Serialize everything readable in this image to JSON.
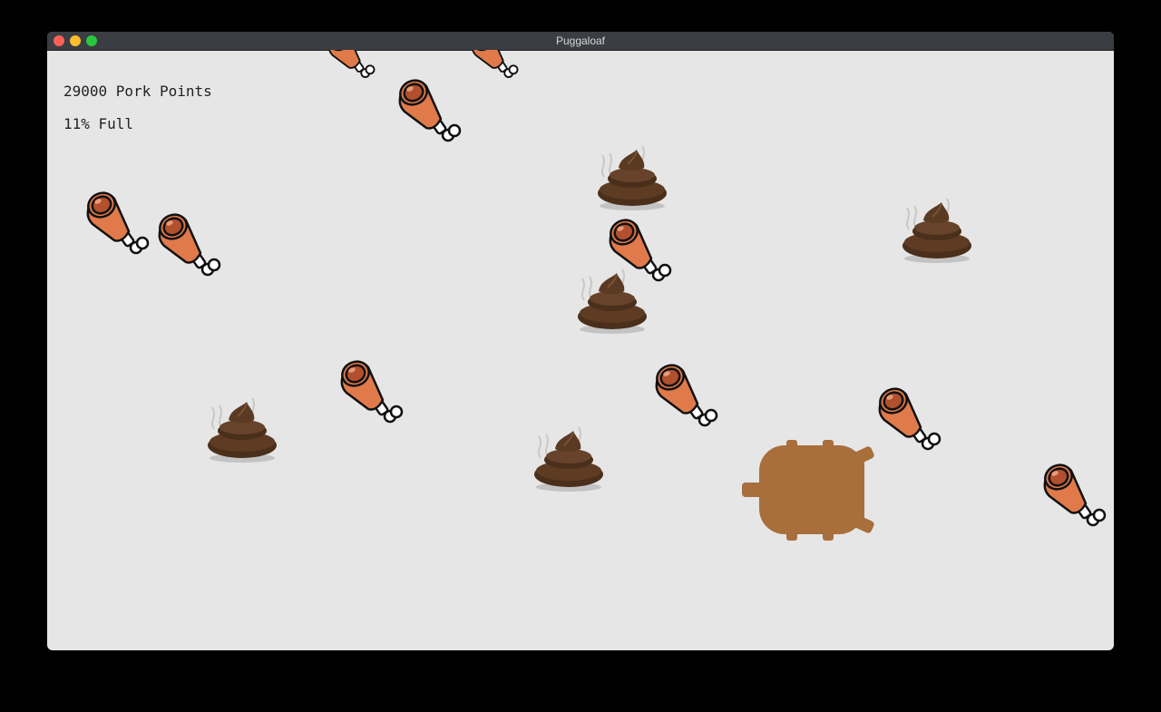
{
  "window": {
    "title": "Puggaloaf",
    "traffic_colors": {
      "close": "#fe5f57",
      "minimize": "#febc2e",
      "maximize": "#28c840"
    }
  },
  "hud": {
    "score_text": "29000 Pork Points",
    "fullness_text": "11% Full"
  },
  "sprites": {
    "meat_icon": "ham-leg-icon",
    "poop_icon": "poop-icon",
    "player_icon": "pug-loaf-player-icon"
  },
  "colors": {
    "background": "#e6e6e6",
    "meat": "#e07a4a",
    "meat_inner": "#b24f2d",
    "poop": "#5a3a22",
    "player": "#a86e3c"
  }
}
